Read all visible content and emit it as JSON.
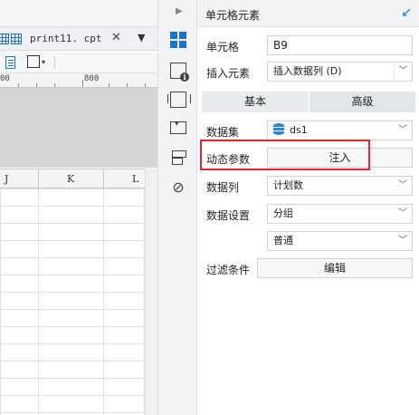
{
  "designer": {
    "tab": {
      "label": "print11. cpt",
      "close": "✕",
      "menu": "▼"
    },
    "ruler": {
      "mark_left": "00",
      "mark_right": "800"
    },
    "columns": [
      "J",
      "K",
      "L"
    ]
  },
  "strip": {
    "collapse_arrow": "▶",
    "icons": [
      "cell-element-icon",
      "cell-attribute-icon",
      "style-icon",
      "widget-icon",
      "condition-icon",
      "hyperlink-icon"
    ]
  },
  "panel": {
    "title": "单元格元素",
    "collapse_icon": "↙",
    "cell": {
      "label": "单元格",
      "value": "B9"
    },
    "insert": {
      "label": "插入元素",
      "value": "插入数据列 (D)"
    },
    "tabs": {
      "basic": "基本",
      "advanced": "高级"
    },
    "dataset": {
      "label": "数据集",
      "value": "ds1"
    },
    "dynamic_param": {
      "label": "动态参数",
      "button": "注入"
    },
    "data_column": {
      "label": "数据列",
      "value": "计划数"
    },
    "data_setting": {
      "label": "数据设置",
      "value": "分组",
      "sub_value": "普通"
    },
    "filter": {
      "label": "过滤条件",
      "button": "编辑"
    }
  },
  "colors": {
    "accent": "#1a73c8",
    "highlight": "#e8232a"
  }
}
